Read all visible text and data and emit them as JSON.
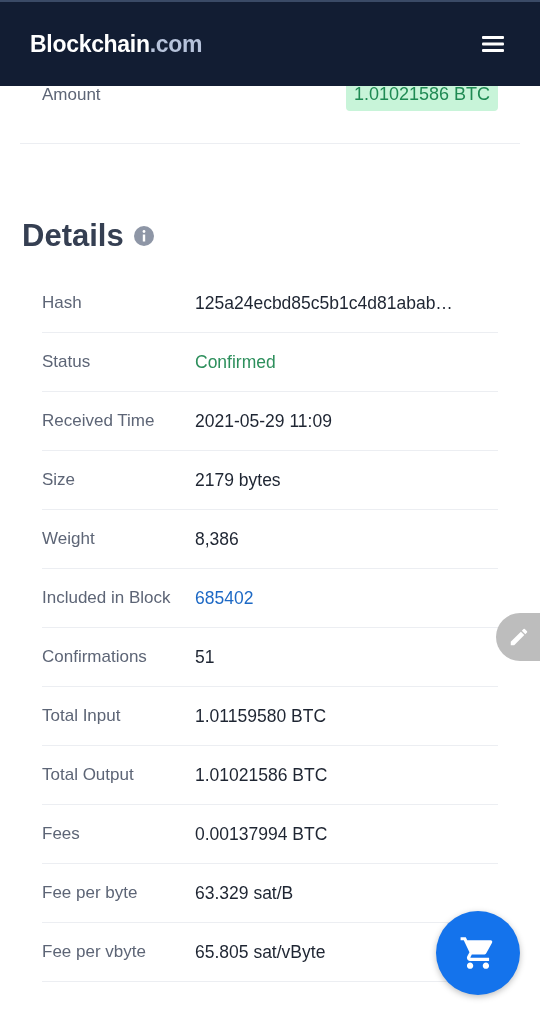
{
  "header": {
    "logo_main": "Blockchain",
    "logo_suffix": ".com"
  },
  "amount_row": {
    "label": "Amount",
    "value": "1.01021586 BTC"
  },
  "details": {
    "title": "Details",
    "rows": [
      {
        "label": "Hash",
        "value": "125a24ecbd85c5b1c4d81abab…",
        "kind": "plain"
      },
      {
        "label": "Status",
        "value": "Confirmed",
        "kind": "status"
      },
      {
        "label": "Received Time",
        "value": "2021-05-29 11:09",
        "kind": "plain"
      },
      {
        "label": "Size",
        "value": "2179 bytes",
        "kind": "plain"
      },
      {
        "label": "Weight",
        "value": "8,386",
        "kind": "plain"
      },
      {
        "label": "Included in Block",
        "value": "685402",
        "kind": "link"
      },
      {
        "label": "Confirmations",
        "value": "51",
        "kind": "plain"
      },
      {
        "label": "Total Input",
        "value": "1.01159580 BTC",
        "kind": "plain"
      },
      {
        "label": "Total Output",
        "value": "1.01021586 BTC",
        "kind": "plain"
      },
      {
        "label": "Fees",
        "value": "0.00137994 BTC",
        "kind": "plain"
      },
      {
        "label": "Fee per byte",
        "value": "63.329 sat/B",
        "kind": "plain"
      },
      {
        "label": "Fee per vbyte",
        "value": "65.805 sat/vByte",
        "kind": "plain"
      }
    ]
  }
}
